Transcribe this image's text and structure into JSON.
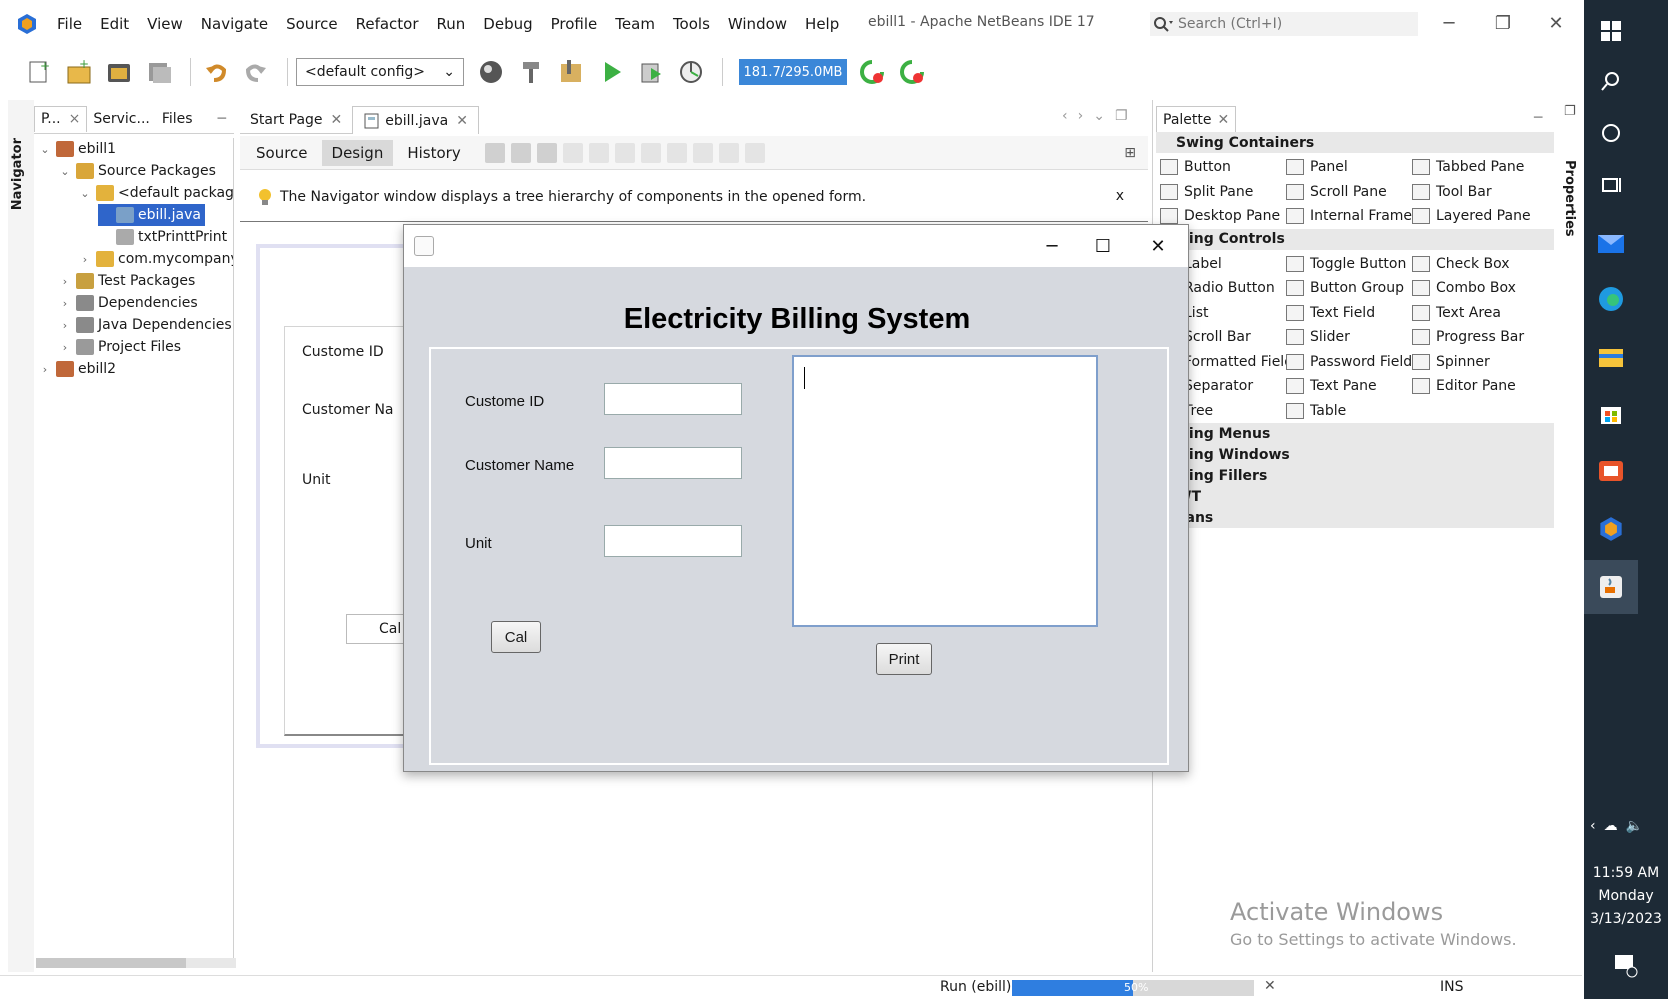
{
  "window": {
    "title": "ebill1 - Apache NetBeans IDE 17",
    "search_placeholder": "Search (Ctrl+I)",
    "minimize_glyph": "─",
    "restore_glyph": "❐",
    "close_glyph": "✕"
  },
  "menu": [
    "File",
    "Edit",
    "View",
    "Navigate",
    "Source",
    "Refactor",
    "Run",
    "Debug",
    "Profile",
    "Team",
    "Tools",
    "Window",
    "Help"
  ],
  "toolbar": {
    "config_value": "<default config>",
    "memory": "181.7/295.0MB"
  },
  "left_panel": {
    "tabs": [
      "P...",
      "Servic...",
      "Files"
    ],
    "navigator_label": "Navigator",
    "tree": [
      {
        "label": "ebill1",
        "level": 0,
        "expanded": true,
        "icon": "project-icon"
      },
      {
        "label": "Source Packages",
        "level": 1,
        "expanded": true,
        "icon": "source-packages-icon"
      },
      {
        "label": "<default package>",
        "level": 2,
        "expanded": true,
        "icon": "package-icon"
      },
      {
        "label": "ebill.java",
        "level": 3,
        "selected": true,
        "icon": "java-form-icon"
      },
      {
        "label": "txtPrinttPrint",
        "level": 3,
        "icon": "java-file-icon"
      },
      {
        "label": "com.mycompany",
        "level": 2,
        "expanded": false,
        "icon": "package-icon"
      },
      {
        "label": "Test Packages",
        "level": 1,
        "expanded": false,
        "icon": "test-packages-icon"
      },
      {
        "label": "Dependencies",
        "level": 1,
        "expanded": false,
        "icon": "dependencies-icon"
      },
      {
        "label": "Java Dependencies",
        "level": 1,
        "expanded": false,
        "icon": "dependencies-icon"
      },
      {
        "label": "Project Files",
        "level": 1,
        "expanded": false,
        "icon": "project-files-icon"
      },
      {
        "label": "ebill2",
        "level": 0,
        "expanded": false,
        "icon": "project-icon"
      }
    ]
  },
  "editor": {
    "tabs": [
      "Start Page",
      "ebill.java"
    ],
    "subtabs": [
      "Source",
      "Design",
      "History"
    ],
    "hint": "The Navigator window displays a tree hierarchy of components in the opened form.",
    "hint_close": "x",
    "design_labels": [
      "Custome ID",
      "Customer Na",
      "Unit"
    ],
    "design_cal": "Cal"
  },
  "palette": {
    "title": "Palette",
    "properties_label": "Properties",
    "categories": [
      {
        "name": "Swing Containers",
        "items": [
          "Button",
          "Panel",
          "Tabbed Pane",
          "Split Pane",
          "Scroll Pane",
          "Tool Bar",
          "Desktop Pane",
          "Internal Frame",
          "Layered Pane"
        ]
      },
      {
        "name": "wing Controls",
        "items": [
          "Label",
          "Toggle Button",
          "Check Box",
          "Radio Button",
          "Button Group",
          "Combo Box",
          "List",
          "Text Field",
          "Text Area",
          "Scroll Bar",
          "Slider",
          "Progress Bar",
          "Formatted Field",
          "Password Field",
          "Spinner",
          "Separator",
          "Text Pane",
          "Editor Pane",
          "Tree",
          "Table"
        ]
      },
      {
        "name": "wing Menus"
      },
      {
        "name": "wing Windows"
      },
      {
        "name": "wing Fillers"
      },
      {
        "name": "WT"
      },
      {
        "name": "eans"
      }
    ],
    "activate_title": "Activate Windows",
    "activate_sub": "Go to Settings to activate Windows."
  },
  "status": {
    "run_label": "Run (ebill)",
    "progress_pct": 50,
    "progress_text": "50%",
    "close": "✕",
    "mode": "INS"
  },
  "taskbar": {
    "time": "11:59 AM",
    "day": "Monday",
    "date": "3/13/2023"
  },
  "app": {
    "heading": "Electricity Billing System",
    "labels": {
      "customer_id": "Custome ID",
      "customer_name": "Customer Name",
      "unit": "Unit"
    },
    "values": {
      "customer_id": "",
      "customer_name": "",
      "unit": ""
    },
    "buttons": {
      "cal": "Cal",
      "print": "Print"
    },
    "window_controls": {
      "minimize": "─",
      "maximize": "☐",
      "close": "✕"
    }
  },
  "colors": {
    "selection": "#2f65ca",
    "memory_bar": "#3b87d8",
    "progress": "#2f7ee0",
    "taskbar": "#1d2a36",
    "app_bg": "#d6d9df"
  }
}
